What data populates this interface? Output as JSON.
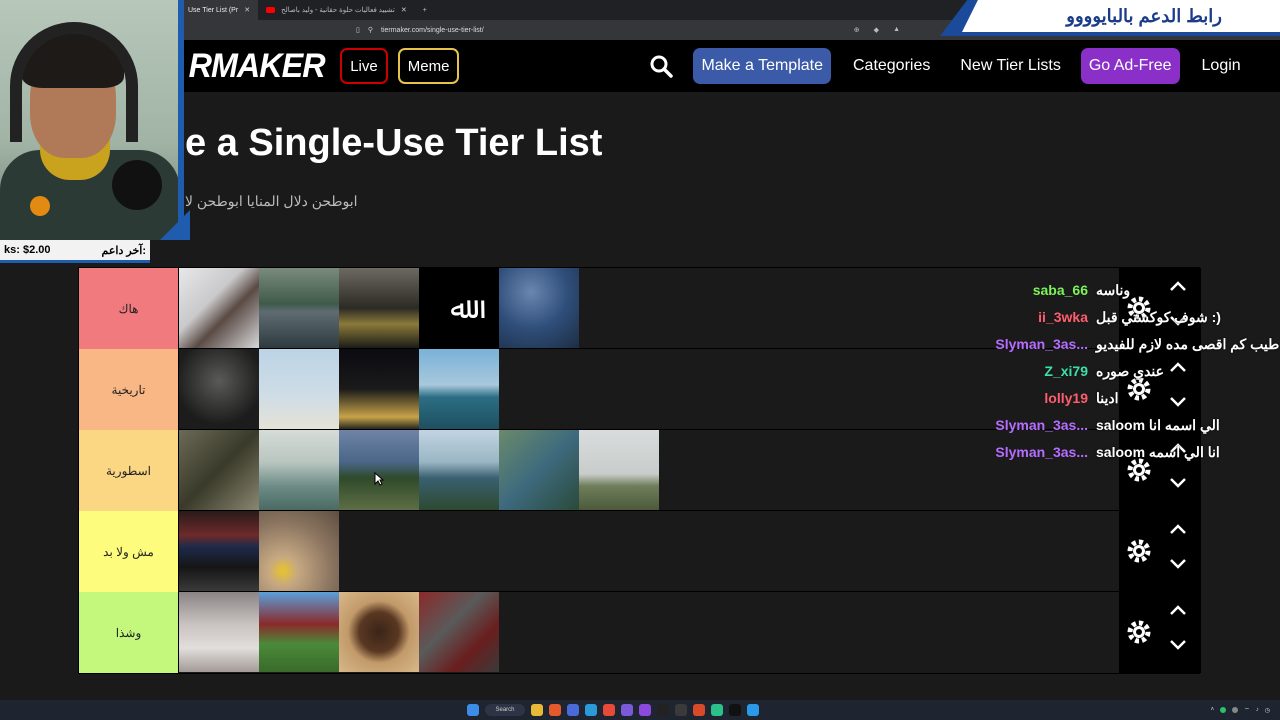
{
  "browser": {
    "tabs": [
      {
        "label": "Use Tier List (Pr",
        "active": true
      },
      {
        "label": "تشييد فعاليات حلوة حقانية - وليد باصالح",
        "active": false
      }
    ],
    "url": "tiermaker.com/single-use-tier-list/"
  },
  "nav": {
    "logo": "RMAKER",
    "live": "Live",
    "meme": "Meme",
    "make_template": "Make a Template",
    "categories": "Categories",
    "new_tier_lists": "New Tier Lists",
    "ad_free": "Go Ad-Free",
    "login": "Login"
  },
  "page": {
    "title": "e a Single-Use Tier List",
    "subtitle": "ابوطحن دلال المنايا ابوطحن لا"
  },
  "tiers": [
    {
      "label": "هاك",
      "color": "#f07a7d"
    },
    {
      "label": "تاريخية",
      "color": "#f8b784"
    },
    {
      "label": "اسطورية",
      "color": "#fbd784"
    },
    {
      "label": "مش ولا بد",
      "color": "#fdfc7c"
    },
    {
      "label": "وشذا",
      "color": "#c4f87d"
    }
  ],
  "overlay": {
    "banner": "رابط الدعم بالبايوووو",
    "donor_label": "آخر داعم:",
    "donor_amount": "ks: $2.00"
  },
  "chat": [
    {
      "name": "saba_66",
      "color": "#7df25a",
      "text": "وناسه"
    },
    {
      "name": "ii_3wka",
      "color": "#ff5d6e",
      "text": "شوف كوكستي قبل :)"
    },
    {
      "name": "Slyman_3as...",
      "color": "#b66cff",
      "text": "طيب كم اقصى مده لازم للفيديو"
    },
    {
      "name": "Z_xi79",
      "color": "#3de0a6",
      "text": "عندي صوره"
    },
    {
      "name": "lolly19",
      "color": "#ff5d6e",
      "text": "ادينا"
    },
    {
      "name": "Slyman_3as...",
      "color": "#b66cff",
      "text": "saloom الي اسمه انا"
    },
    {
      "name": "Slyman_3as...",
      "color": "#b66cff",
      "text": "saloom انا الي اسمه"
    }
  ],
  "taskbar": {
    "search": "Search"
  }
}
